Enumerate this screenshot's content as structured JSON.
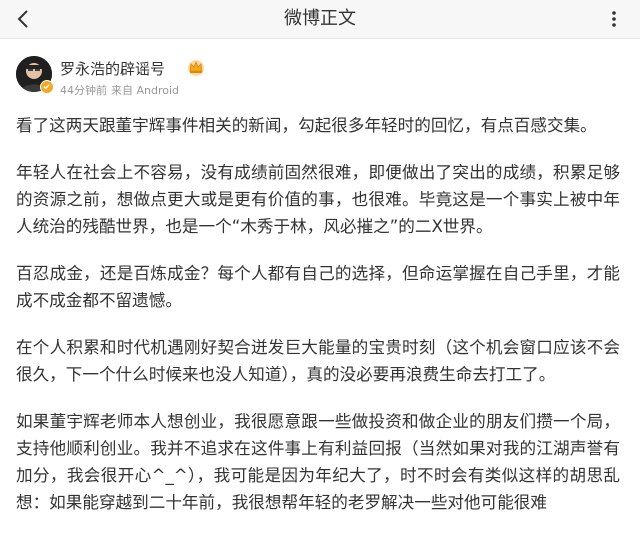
{
  "nav": {
    "title": "微博正文",
    "back_icon": "chevron-left-icon",
    "more_icon": "more-vertical-icon"
  },
  "author": {
    "name": "罗永浩的辟谣号",
    "time": "44分钟前",
    "source": "来自 Android",
    "badge_color": "#f5a623",
    "crown_icon": "crown-icon"
  },
  "post": {
    "paragraphs": [
      "看了这两天跟董宇辉事件相关的新闻，勾起很多年轻时的回忆，有点百感交集。",
      "年轻人在社会上不容易，没有成绩前固然很难，即便做出了突出的成绩，积累足够的资源之前，想做点更大或是更有价值的事，也很难。毕竟这是一个事实上被中年人统治的残酷世界，也是一个“木秀于林，风必摧之”的二X世界。",
      "百忍成金，还是百炼成金？每个人都有自己的选择，但命运掌握在自己手里，才能成不成金都不留遗憾。",
      "在个人积累和时代机遇刚好契合迸发巨大能量的宝贵时刻（这个机会窗口应该不会很久，下一个什么时候来也没人知道），真的没必要再浪费生命去打工了。",
      "如果董宇辉老师本人想创业，我很愿意跟一些做投资和做企业的朋友们攒一个局，支持他顺利创业。我并不追求在这件事上有利益回报（当然如果对我的江湖声誉有加分，我会很开心^_^），我可能是因为年纪大了，时不时会有类似这样的胡思乱想：如果能穿越到二十年前，我很想帮年轻的老罗解决一些对他可能很难"
    ]
  }
}
